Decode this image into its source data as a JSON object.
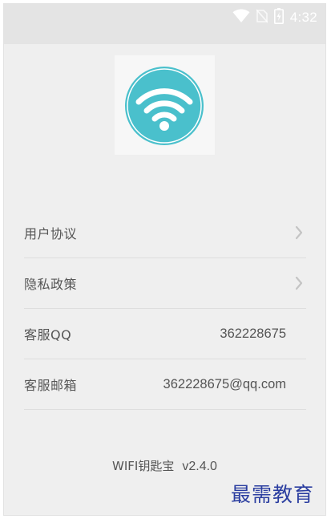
{
  "status_bar": {
    "time": "4:32",
    "icons": [
      "wifi-icon",
      "no-sim-icon",
      "battery-charging-icon"
    ]
  },
  "logo": {
    "icon": "wifi-icon",
    "color": "#4ac0cc"
  },
  "menu": {
    "items": [
      {
        "label": "用户协议",
        "value": "",
        "has_chevron": true
      },
      {
        "label": "隐私政策",
        "value": "",
        "has_chevron": true
      },
      {
        "label": "客服QQ",
        "value": "362228675",
        "has_chevron": false
      },
      {
        "label": "客服邮箱",
        "value": "362228675@qq.com",
        "has_chevron": false
      }
    ]
  },
  "footer": {
    "app_name": "WIFI钥匙宝",
    "version": "v2.4.0"
  },
  "watermark": "最需教育"
}
